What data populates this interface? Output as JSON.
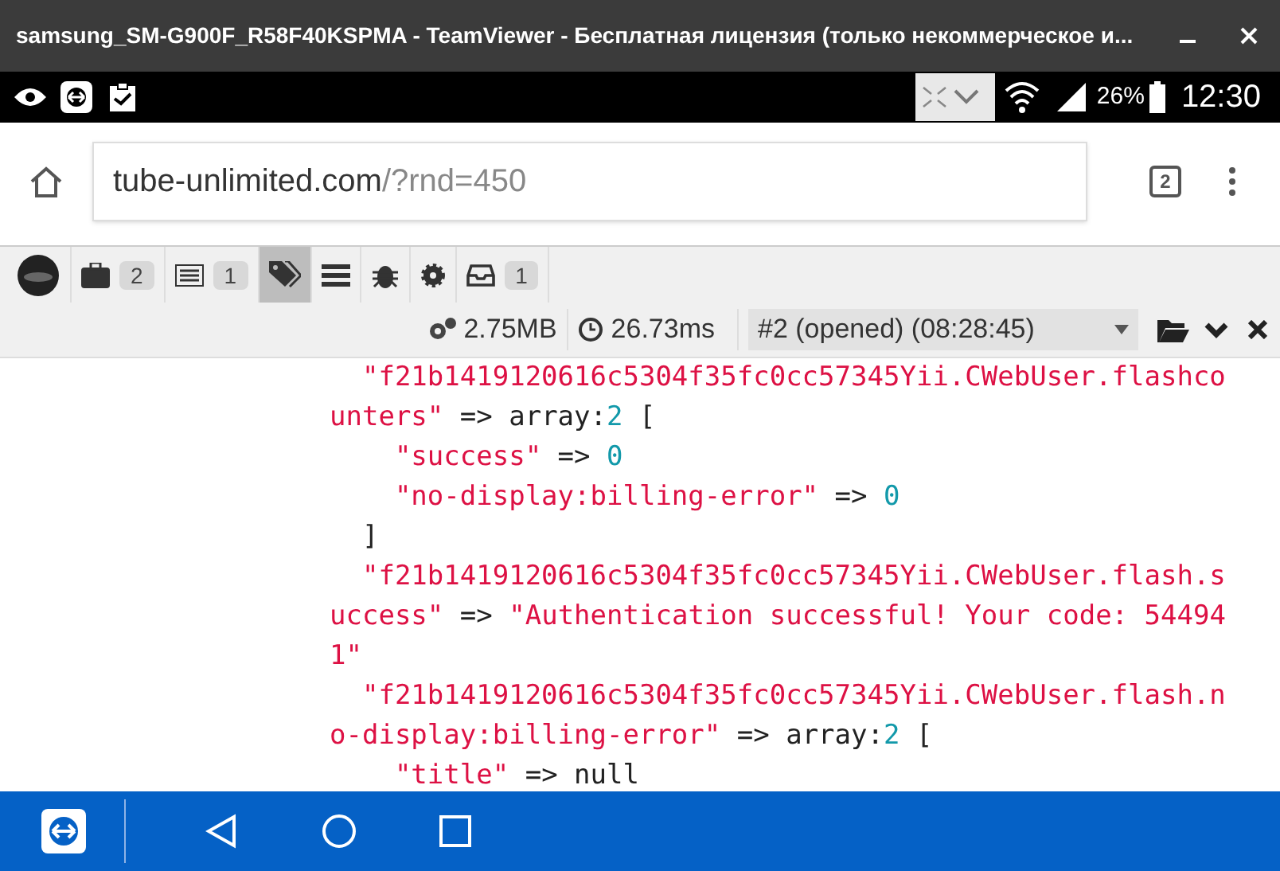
{
  "window": {
    "title": "samsung_SM-G900F_R58F40KSPMA - TeamViewer - Бесплатная лицензия (только некоммерческое и..."
  },
  "status_bar": {
    "battery": "26%",
    "time": "12:30"
  },
  "browser": {
    "url_host": "tube-unlimited.com",
    "url_path": "/?rnd=450",
    "tab_count": "2"
  },
  "debug_toolbar": {
    "panels": [
      {
        "kind": "logo",
        "selected": false
      },
      {
        "kind": "briefcase",
        "count": "2",
        "selected": false
      },
      {
        "kind": "list",
        "count": "1",
        "selected": false
      },
      {
        "kind": "tags",
        "selected": true
      },
      {
        "kind": "bars",
        "selected": false
      },
      {
        "kind": "bug",
        "selected": false
      },
      {
        "kind": "gear",
        "selected": false
      },
      {
        "kind": "inbox",
        "count": "1",
        "selected": false
      }
    ],
    "memory": "2.75MB",
    "time": "26.73ms",
    "request": "#2 (opened) (08:28:45)"
  },
  "code_lines": [
    [
      {
        "kind": "string",
        "text": "  \"f21b1419120616c5304f35fc0cc57345Yii.CWebUser.flashco"
      }
    ],
    [
      {
        "kind": "string",
        "text": "unters\""
      },
      {
        "kind": "plain",
        "text": " => array:"
      },
      {
        "kind": "number",
        "text": "2"
      },
      {
        "kind": "plain",
        "text": " ["
      }
    ],
    [
      {
        "kind": "string",
        "text": "    \"success\""
      },
      {
        "kind": "plain",
        "text": " => "
      },
      {
        "kind": "number",
        "text": "0"
      }
    ],
    [
      {
        "kind": "string",
        "text": "    \"no-display:billing-error\""
      },
      {
        "kind": "plain",
        "text": " => "
      },
      {
        "kind": "number",
        "text": "0"
      }
    ],
    [
      {
        "kind": "plain",
        "text": "  ]"
      }
    ],
    [
      {
        "kind": "string",
        "text": "  \"f21b1419120616c5304f35fc0cc57345Yii.CWebUser.flash.s"
      }
    ],
    [
      {
        "kind": "string",
        "text": "uccess\""
      },
      {
        "kind": "plain",
        "text": " => "
      },
      {
        "kind": "string",
        "text": "\"Authentication successful! Your code: 54494"
      }
    ],
    [
      {
        "kind": "string",
        "text": "1\""
      }
    ],
    [
      {
        "kind": "string",
        "text": "  \"f21b1419120616c5304f35fc0cc57345Yii.CWebUser.flash.n"
      }
    ],
    [
      {
        "kind": "string",
        "text": "o-display:billing-error\""
      },
      {
        "kind": "plain",
        "text": " => array:"
      },
      {
        "kind": "number",
        "text": "2"
      },
      {
        "kind": "plain",
        "text": " ["
      }
    ],
    [
      {
        "kind": "string",
        "text": "    \"title\""
      },
      {
        "kind": "plain",
        "text": " => null"
      }
    ]
  ]
}
